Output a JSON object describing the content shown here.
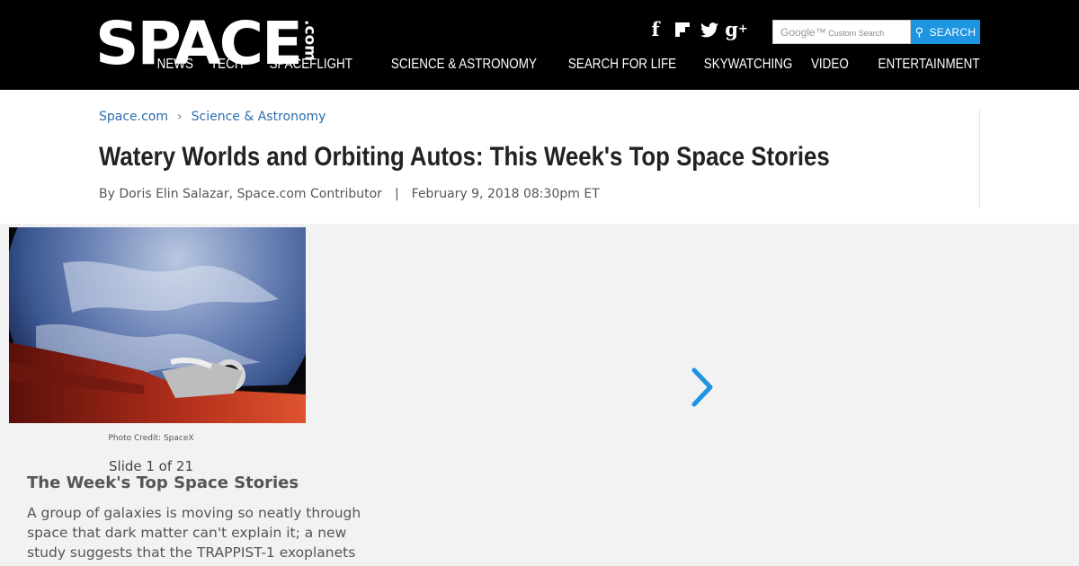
{
  "header": {
    "logo_text": "SPACE",
    "logo_suffix": ".com",
    "social": [
      {
        "name": "facebook-icon",
        "glyph": "f"
      },
      {
        "name": "flipboard-icon",
        "glyph": "▛"
      },
      {
        "name": "twitter-icon",
        "glyph": "🐦"
      },
      {
        "name": "google-plus-icon",
        "glyph": "g+"
      }
    ],
    "search_placeholder_brand": "Google™",
    "search_placeholder": "Custom Search",
    "search_button": "SEARCH",
    "nav": [
      "NEWS",
      "TECH",
      "SPACEFLIGHT",
      "SCIENCE & ASTRONOMY",
      "SEARCH FOR LIFE",
      "SKYWATCHING",
      "VIDEO",
      "ENTERTAINMENT"
    ]
  },
  "breadcrumb": {
    "home": "Space.com",
    "separator": "›",
    "section": "Science & Astronomy"
  },
  "article": {
    "title": "Watery Worlds and Orbiting Autos: This Week's Top Space Stories",
    "author": "By Doris Elin Salazar, Space.com Contributor",
    "separator": "|",
    "date": "February 9, 2018 08:30pm ET"
  },
  "slideshow": {
    "photo_credit": "Photo Credit: SpaceX",
    "counter": "Slide 1 of 21",
    "slide_title": "The Week's Top Space Stories",
    "slide_text": "A group of galaxies is moving so neatly through space that dark matter can't explain it; a new study suggests that the TRAPPIST-1 exoplanets"
  },
  "colors": {
    "header_bg": "#000000",
    "accent_blue": "#1d95e1",
    "link_blue": "#2c6dac"
  }
}
